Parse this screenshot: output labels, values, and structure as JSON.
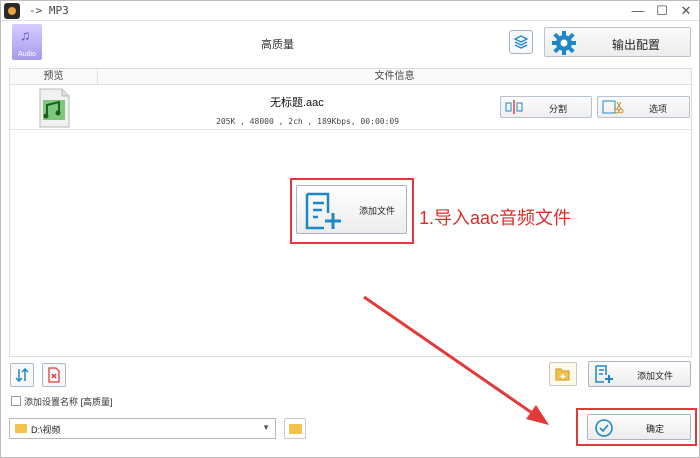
{
  "window": {
    "title": "-> MP3",
    "minimize": "—",
    "maximize": "☐",
    "close": "✕"
  },
  "header": {
    "profile_badge": "Audio",
    "quality": "高质量",
    "output_settings": "输出配置"
  },
  "table": {
    "columns": [
      "预览",
      "文件信息"
    ],
    "rows": [
      {
        "filename": "无标题.aac",
        "info": "205K , 48000 , 2ch , 189Kbps, 00:00:09",
        "split_label": "分割",
        "options_label": "选项"
      }
    ]
  },
  "center": {
    "add_file": "添加文件"
  },
  "annotation": {
    "text": "1.导入aac音频文件",
    "color": "#e12b2b"
  },
  "bottom": {
    "add_file": "添加文件",
    "checkbox_label": "添加设置名称 [高质量]",
    "checkbox_checked": false,
    "path": "D:\\视频",
    "confirm": "确定"
  },
  "colors": {
    "accent_blue": "#1e87c8",
    "highlight_red": "#e23a3a",
    "folder_yellow": "#f2c14e"
  }
}
